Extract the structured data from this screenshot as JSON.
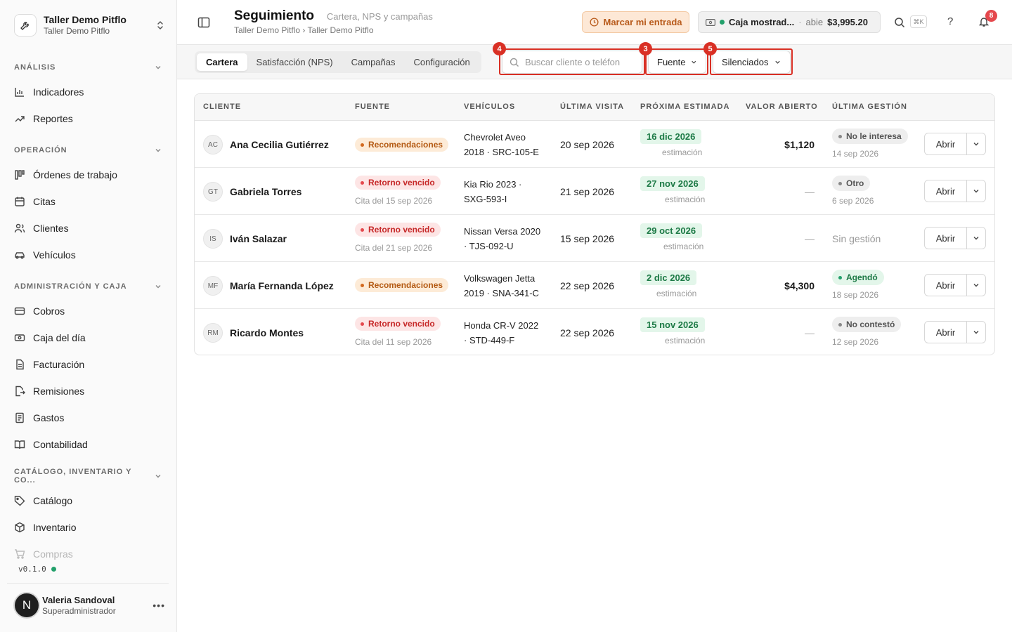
{
  "workspace": {
    "name": "Taller Demo Pitflo",
    "subtitle": "Taller Demo Pitflo"
  },
  "sidebar": {
    "sections": [
      {
        "title": "ANÁLISIS",
        "items": [
          {
            "label": "Indicadores",
            "icon": "chart-bars-icon"
          },
          {
            "label": "Reportes",
            "icon": "trend-up-icon"
          }
        ]
      },
      {
        "title": "OPERACIÓN",
        "items": [
          {
            "label": "Órdenes de trabajo",
            "icon": "kanban-icon"
          },
          {
            "label": "Citas",
            "icon": "calendar-icon"
          },
          {
            "label": "Clientes",
            "icon": "users-icon"
          },
          {
            "label": "Vehículos",
            "icon": "car-icon"
          }
        ]
      },
      {
        "title": "ADMINISTRACIÓN Y CAJA",
        "items": [
          {
            "label": "Cobros",
            "icon": "credit-card-icon"
          },
          {
            "label": "Caja del día",
            "icon": "cash-icon"
          },
          {
            "label": "Facturación",
            "icon": "document-icon"
          },
          {
            "label": "Remisiones",
            "icon": "export-file-icon"
          },
          {
            "label": "Gastos",
            "icon": "receipt-icon"
          },
          {
            "label": "Contabilidad",
            "icon": "book-icon"
          }
        ]
      },
      {
        "title": "CATÁLOGO, INVENTARIO Y CO...",
        "items": [
          {
            "label": "Catálogo",
            "icon": "tag-icon"
          },
          {
            "label": "Inventario",
            "icon": "box-icon"
          },
          {
            "label": "Compras",
            "icon": "cart-icon"
          }
        ]
      }
    ],
    "version": "v0.1.0",
    "user": {
      "initial": "N",
      "name": "Valeria Sandoval",
      "role": "Superadministrador"
    }
  },
  "header": {
    "title": "Seguimiento",
    "subtitle": "Cartera, NPS y campañas",
    "breadcrumb": "Taller Demo Pitflo › Taller Demo Pitflo",
    "entry_button": "Marcar mi entrada",
    "register": {
      "name": "Caja mostrad...",
      "separator": "·",
      "status": "abie",
      "amount": "$3,995.20"
    },
    "shortcut": "⌘K",
    "help": "?",
    "notifications": "8"
  },
  "tabs": [
    "Cartera",
    "Satisfacción (NPS)",
    "Campañas",
    "Configuración"
  ],
  "filters": {
    "search_placeholder": "Buscar cliente o teléfon",
    "source_label": "Fuente",
    "muted_label": "Silenciados",
    "markers": {
      "search": "4",
      "source": "3",
      "muted": "5"
    }
  },
  "table": {
    "columns": [
      "CLIENTE",
      "FUENTE",
      "VEHÍCULOS",
      "ÚLTIMA VISITA",
      "PRÓXIMA ESTIMADA",
      "VALOR ABIERTO",
      "ÚLTIMA GESTIÓN"
    ],
    "open_label": "Abrir",
    "rows": [
      {
        "initials": "AC",
        "name": "Ana Cecilia Gutiérrez",
        "source": "Recomendaciones",
        "source_type": "rec",
        "source_sub": "",
        "vehicle1": "Chevrolet Aveo",
        "vehicle2": "2018 · SRC-105-E",
        "visit": "20 sep 2026",
        "next": "16 dic 2026",
        "next_sub": "estimación",
        "value": "$1,120",
        "status": "No le interesa",
        "status_type": "gray",
        "status_date": "14 sep 2026"
      },
      {
        "initials": "GT",
        "name": "Gabriela Torres",
        "source": "Retorno vencido",
        "source_type": "ret",
        "source_sub": "Cita del 15 sep 2026",
        "vehicle1": "Kia Rio 2023 ·",
        "vehicle2": "SXG-593-I",
        "visit": "21 sep 2026",
        "next": "27 nov 2026",
        "next_sub": "estimación",
        "value": "—",
        "status": "Otro",
        "status_type": "gray",
        "status_date": "6 sep 2026"
      },
      {
        "initials": "IS",
        "name": "Iván Salazar",
        "source": "Retorno vencido",
        "source_type": "ret",
        "source_sub": "Cita del 21 sep 2026",
        "vehicle1": "Nissan Versa 2020",
        "vehicle2": "· TJS-092-U",
        "visit": "15 sep 2026",
        "next": "29 oct 2026",
        "next_sub": "estimación",
        "value": "—",
        "status": "Sin gestión",
        "status_type": "none",
        "status_date": ""
      },
      {
        "initials": "MF",
        "name": "María Fernanda López",
        "source": "Recomendaciones",
        "source_type": "rec",
        "source_sub": "",
        "vehicle1": "Volkswagen Jetta",
        "vehicle2": "2019 · SNA-341-C",
        "visit": "22 sep 2026",
        "next": "2 dic 2026",
        "next_sub": "estimación",
        "value": "$4,300",
        "status": "Agendó",
        "status_type": "green",
        "status_date": "18 sep 2026"
      },
      {
        "initials": "RM",
        "name": "Ricardo Montes",
        "source": "Retorno vencido",
        "source_type": "ret",
        "source_sub": "Cita del 11 sep 2026",
        "vehicle1": "Honda CR-V 2022",
        "vehicle2": "· STD-449-F",
        "visit": "22 sep 2026",
        "next": "15 nov 2026",
        "next_sub": "estimación",
        "value": "—",
        "status": "No contestó",
        "status_type": "gray",
        "status_date": "12 sep 2026"
      }
    ]
  }
}
